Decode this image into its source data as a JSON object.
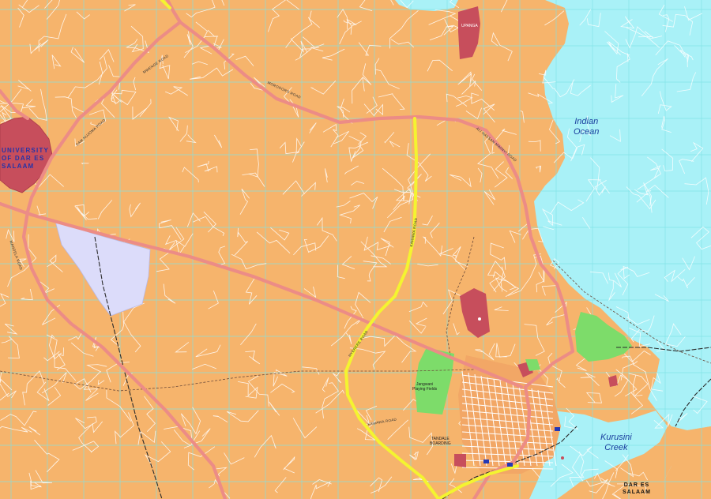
{
  "map": {
    "water_labels": {
      "indian_ocean_line1": "Indian",
      "indian_ocean_line2": "Ocean",
      "kurusini_line1": "Kurusini",
      "kurusini_line2": "Creek"
    },
    "places": {
      "university_line1": "UNIVERSITY",
      "university_line2": "OF DAR ES",
      "university_line3": "SALAAM",
      "city_line1": "DAR ES",
      "city_line2": "SALAAM",
      "jangwani_line1": "Jangwani",
      "jangwani_line2": "Playing Fields",
      "tandale_line1": "TANDALE",
      "tandale_line2": "BOARDING",
      "upanga": "UPANGA"
    },
    "roads": {
      "sam_nujoma": "SAM NUJOMA ROAD",
      "morogoro": "MOROGORO ROAD",
      "mandela": "MANDELA ROAD",
      "kawawa": "KAWAWA ROAD",
      "ali_hassan_mwinyi": "ALI HASSAN MWINYI ROAD",
      "kawawa_south": "KAWAWA ROAD",
      "mwenge": "MWENGE ROAD",
      "nyerere": "NYERERE ROAD"
    },
    "colors": {
      "land": "#f6b46c",
      "water": "#a9f1f7",
      "grid": "#7fe3e6",
      "major_road": "#ec8c86",
      "highway": "#f4f430",
      "institution": "#c74e5c",
      "park": "#7ddc6a",
      "residential_lilac": "#dcdcfa",
      "minor_road": "#ffffff"
    },
    "icons": [
      "grid-lines",
      "railway-lines",
      "boundary-lines"
    ]
  }
}
